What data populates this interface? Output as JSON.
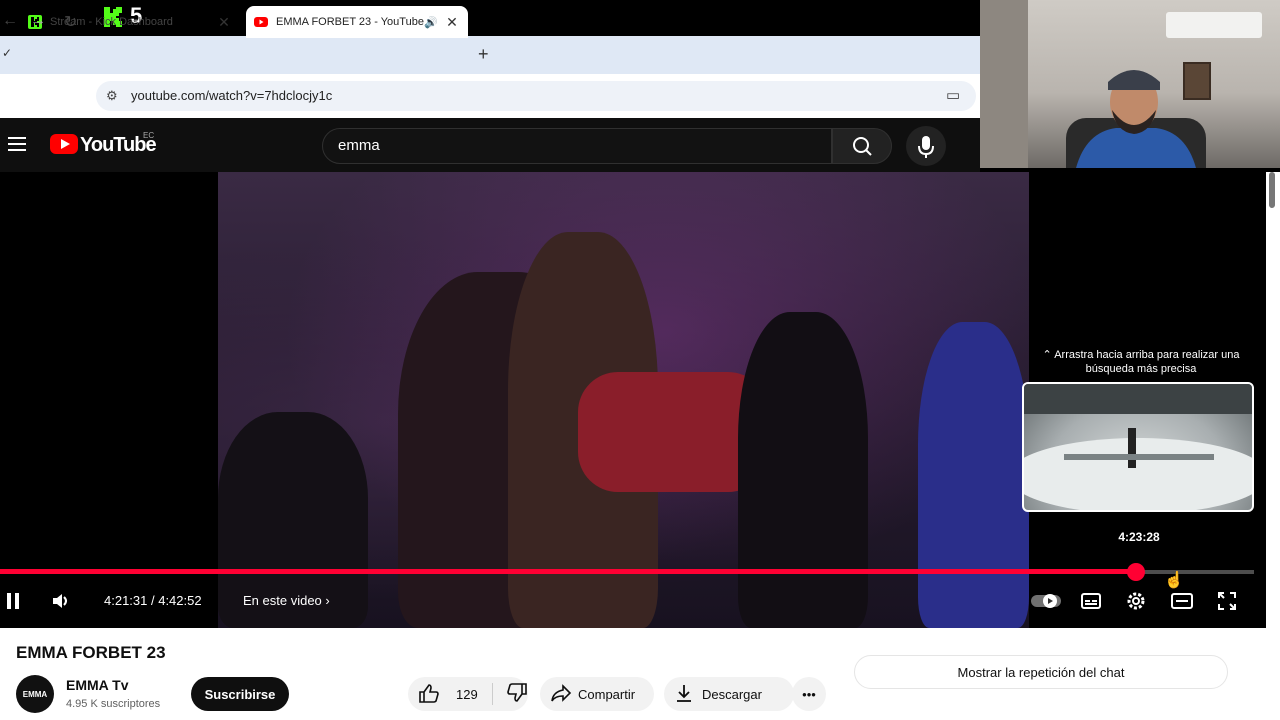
{
  "stream_overlay": {
    "logo_letter": "K",
    "count": "5"
  },
  "browser": {
    "tabs": [
      {
        "title": "Stream - Kick Dashboard",
        "active": false
      },
      {
        "title": "EMMA FORBET 23 - YouTube",
        "active": true
      }
    ],
    "new_tab": "+",
    "address": "youtube.com/watch?v=7hdclocjy1c"
  },
  "youtube": {
    "logo_text": "YouTube",
    "country_code": "EC",
    "search_query": "emma"
  },
  "player": {
    "preview_hint": "⌃ Arrastra hacia arriba para realizar una búsqueda más precisa",
    "preview_time": "4:23:28",
    "current_time": "4:21:31 / 4:42:52",
    "chapter_label": "En este video",
    "progress_fraction": 0.906
  },
  "video_info": {
    "title": "EMMA FORBET 23",
    "channel_name": "EMMA Tv",
    "channel_avatar_text": "EMMA",
    "subscribers": "4.95 K suscriptores",
    "subscribe_label": "Suscribirse",
    "likes": "129",
    "share_label": "Compartir",
    "download_label": "Descargar",
    "chat_replay_label": "Mostrar la repetición del chat"
  },
  "colors": {
    "youtube_red": "#ff0000",
    "progress_red": "#ff0033",
    "kick_green": "#53fc18"
  }
}
